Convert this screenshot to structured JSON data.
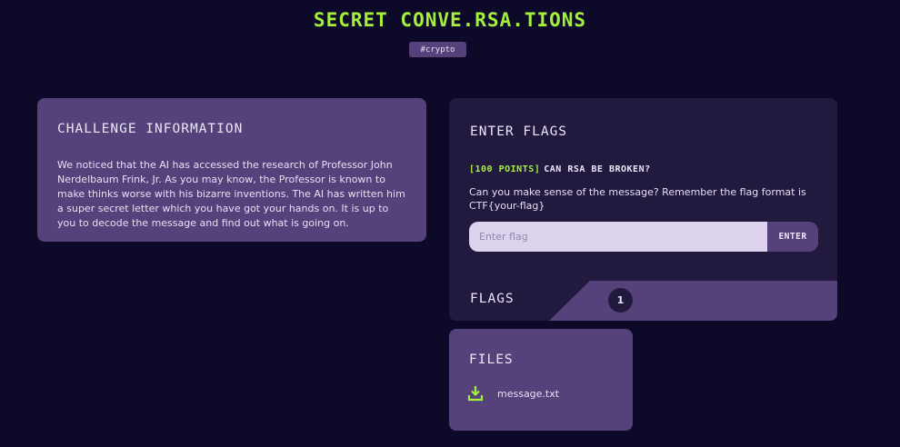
{
  "header": {
    "title": "SECRET CONVE.RSA.TIONS",
    "tag": "#crypto"
  },
  "challenge": {
    "heading": "CHALLENGE INFORMATION",
    "description": "We noticed that the AI has accessed the research of Professor John Nerdelbaum Frink, Jr. As you may know, the Professor is known to make thinks worse with his bizarre inventions. The AI has written him a super secret letter which you have got your hands on. It is up to you to decode the message and find out what is going on."
  },
  "flags_panel": {
    "heading": "ENTER FLAGS",
    "question_points": "[100 POINTS]",
    "question_title": "CAN RSA BE BROKEN?",
    "question_text": "Can you make sense of the message? Remember the flag format is CTF{your-flag}",
    "input_placeholder": "Enter flag",
    "input_value": "",
    "enter_label": "ENTER",
    "flags_label": "FLAGS",
    "flag_count": "1"
  },
  "files": {
    "heading": "FILES",
    "items": [
      {
        "name": "message.txt",
        "icon": "download-icon"
      }
    ]
  },
  "colors": {
    "background": "#0d0929",
    "accent": "#a5f03c",
    "card_light": "#55427a",
    "card_dark": "#22193f",
    "input_bg": "#ddd3ee"
  }
}
